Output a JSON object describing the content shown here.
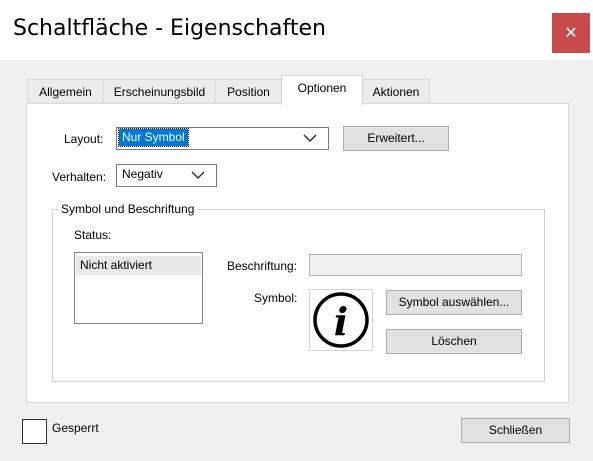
{
  "window": {
    "title": "Schaltfläche - Eigenschaften",
    "close_label": "✕"
  },
  "tabs": [
    {
      "label": "Allgemein"
    },
    {
      "label": "Erscheinungsbild"
    },
    {
      "label": "Position"
    },
    {
      "label": "Optionen",
      "active": true
    },
    {
      "label": "Aktionen"
    }
  ],
  "options": {
    "layout_label": "Layout:",
    "layout_value": "Nur Symbol",
    "advanced_label": "Erweitert...",
    "behavior_label": "Verhalten:",
    "behavior_value": "Negativ",
    "group_title": "Symbol und Beschriftung",
    "status_label": "Status:",
    "status_items": [
      "Nicht aktiviert"
    ],
    "caption_label": "Beschriftung:",
    "caption_value": "",
    "symbol_label": "Symbol:",
    "select_symbol_label": "Symbol auswählen...",
    "clear_label": "Löschen",
    "symbol_icon": "info-icon"
  },
  "footer": {
    "locked_label": "Gesperrt",
    "close_label": "Schließen"
  },
  "colors": {
    "close_button": "#c94a4a",
    "selection": "#0078d7"
  }
}
